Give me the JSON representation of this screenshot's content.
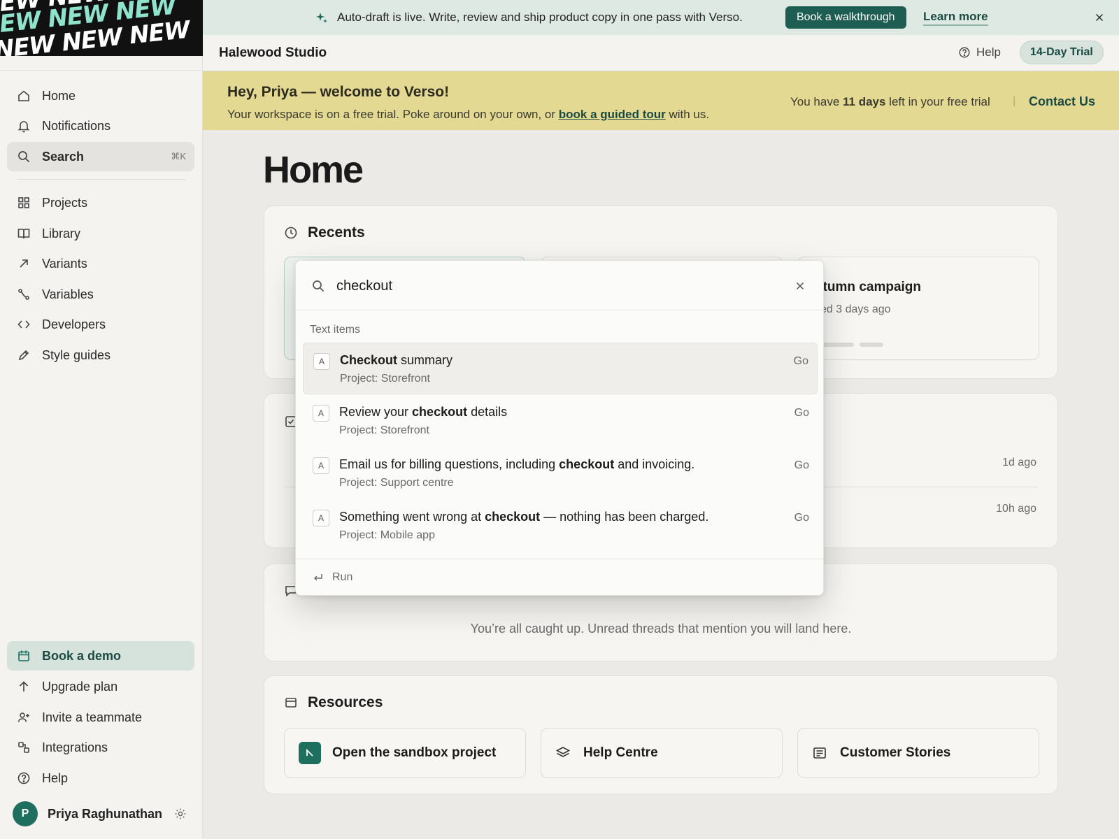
{
  "logo": {
    "repeat_text": "NEW NEW NEW"
  },
  "announcement": {
    "message": "Auto-draft is live. Write, review and ship product copy in one pass with Verso.",
    "cta_label": "Book a walkthrough",
    "link_label": "Learn more"
  },
  "header": {
    "org_name": "Halewood Studio",
    "help_label": "Help",
    "trial_badge": "14-Day Trial"
  },
  "welcome": {
    "title": "Hey, Priya — welcome to Verso!",
    "sub_before": "Your workspace is on a free trial. Poke around on your own, or ",
    "sub_link": "book a guided tour",
    "sub_after": " with us.",
    "trial_before": "You have ",
    "trial_days": "11 days",
    "trial_after": " left in your free trial",
    "separator": "|",
    "contact_label": "Contact Us"
  },
  "sidebar": {
    "primary": [
      {
        "label": "Home",
        "icon": "home-icon"
      },
      {
        "label": "Notifications",
        "icon": "bell-icon"
      },
      {
        "label": "Search",
        "icon": "search-icon",
        "shortcut": "⌘K"
      }
    ],
    "secondary": [
      {
        "label": "Projects",
        "icon": "grid-icon"
      },
      {
        "label": "Library",
        "icon": "book-icon"
      },
      {
        "label": "Variants",
        "icon": "arrow-up-right-icon"
      },
      {
        "label": "Variables",
        "icon": "variable-icon"
      },
      {
        "label": "Developers",
        "icon": "code-icon"
      },
      {
        "label": "Style guides",
        "icon": "pencil-icon"
      }
    ],
    "bottom": [
      {
        "label": "Book a demo",
        "icon": "calendar-icon"
      },
      {
        "label": "Upgrade plan",
        "icon": "arrow-up-icon"
      },
      {
        "label": "Invite a teammate",
        "icon": "user-plus-icon"
      },
      {
        "label": "Integrations",
        "icon": "puzzle-icon"
      },
      {
        "label": "Help",
        "icon": "help-icon"
      }
    ],
    "user": {
      "initial": "P",
      "name": "Priya Raghunathan"
    }
  },
  "main": {
    "title": "Home",
    "recents": {
      "heading": "Recents",
      "visible_tile": {
        "name": "utumn campaign",
        "meta": "ited 3 days ago"
      }
    },
    "activity": {
      "times": [
        "1d ago",
        "10h ago"
      ]
    },
    "threads": {
      "empty_message": "You’re all caught up. Unread threads that mention you will land here."
    },
    "resources": {
      "heading": "Resources",
      "tiles": [
        "Open the sandbox project",
        "Help Centre",
        "Customer Stories"
      ]
    }
  },
  "search_modal": {
    "query": "checkout",
    "section_label": "Text items",
    "results": [
      {
        "badge": "A",
        "before": "",
        "match": "Checkout",
        "after": " summary",
        "project": "Project: Storefront",
        "go": "Go"
      },
      {
        "badge": "A",
        "before": "Review your ",
        "match": "checkout",
        "after": " details",
        "project": "Project: Storefront",
        "go": "Go"
      },
      {
        "badge": "A",
        "before": "Email us for billing questions, including ",
        "match": "checkout",
        "after": " and invoicing.",
        "project": "Project: Support centre",
        "go": "Go"
      },
      {
        "badge": "A",
        "before": "Something went wrong at ",
        "match": "checkout",
        "after": " — nothing has been charged.",
        "project": "Project: Mobile app",
        "go": "Go"
      }
    ],
    "footer_label": "Run"
  },
  "colors": {
    "accent": "#1e5e52",
    "banner": "#e4d993",
    "announce_bg": "#dfe9e4",
    "sidebar_bg": "#f4f3f0"
  }
}
